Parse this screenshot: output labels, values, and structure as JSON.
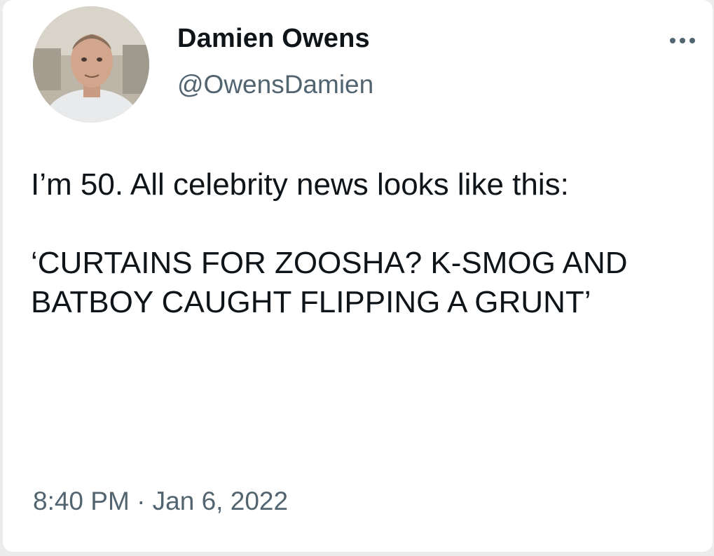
{
  "author": {
    "display_name": "Damien Owens",
    "handle": "@OwensDamien",
    "avatar_icon": "profile-photo"
  },
  "tweet": {
    "paragraph_1": "I’m 50. All celebrity news looks like this:",
    "paragraph_2": "‘CURTAINS FOR ZOOSHA? K-SMOG AND BATBOY CAUGHT FLIPPING A GRUNT’",
    "timestamp": "8:40 PM · Jan 6, 2022"
  },
  "menu": {
    "more_icon": "more-horizontal-icon"
  },
  "colors": {
    "primary_text": "#0f1419",
    "secondary_text": "#536471",
    "background": "#ffffff"
  }
}
